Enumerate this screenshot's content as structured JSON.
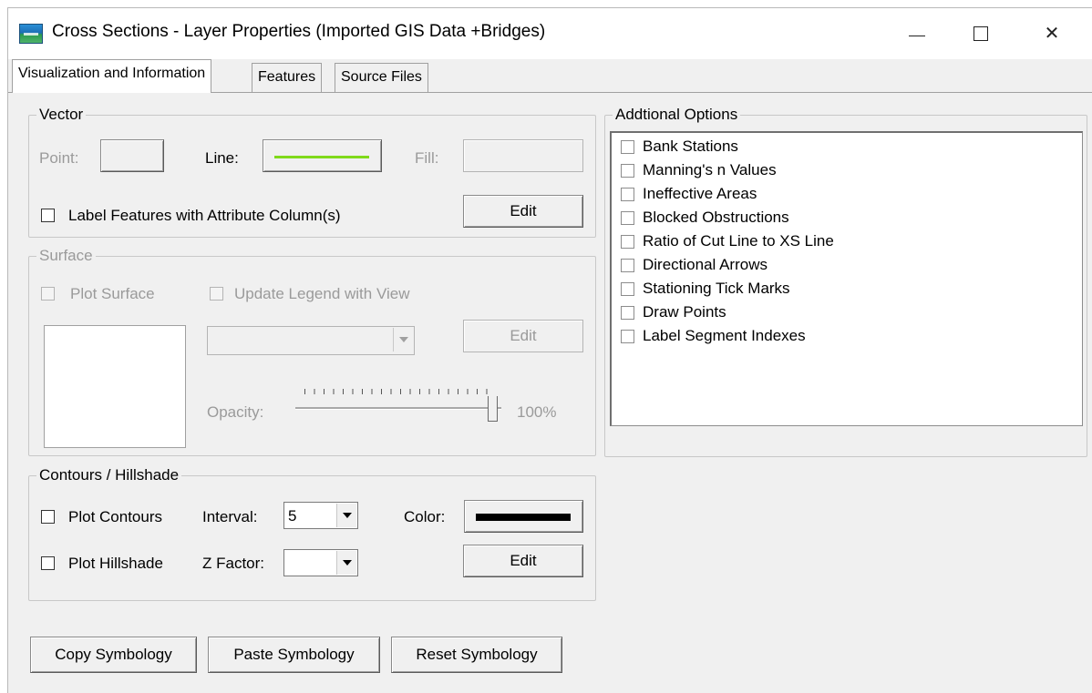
{
  "window": {
    "title": "Cross Sections - Layer Properties (Imported GIS Data +Bridges)",
    "minimize_glyph": "—",
    "maximize_glyph": "☐",
    "close_glyph": "✕"
  },
  "tabs": [
    {
      "label": "Visualization and Information",
      "active": true
    },
    {
      "label": "Features",
      "active": false
    },
    {
      "label": "Source Files",
      "active": false
    }
  ],
  "vector": {
    "legend": "Vector",
    "point_label": "Point:",
    "line_label": "Line:",
    "fill_label": "Fill:",
    "line_color": "#7fd91a",
    "label_features_label": "Label Features with Attribute Column(s)",
    "label_features_checked": false,
    "edit_label": "Edit"
  },
  "surface": {
    "legend": "Surface",
    "plot_surface_label": "Plot Surface",
    "update_legend_label": "Update Legend with View",
    "edit_label": "Edit",
    "opacity_label": "Opacity:",
    "opacity_value": "100%",
    "opacity_fraction": 1.0,
    "enabled": false
  },
  "contours": {
    "legend": "Contours / Hillshade",
    "plot_contours_label": "Plot Contours",
    "interval_label": "Interval:",
    "interval_value": "5",
    "color_label": "Color:",
    "contour_color": "#000000",
    "plot_hillshade_label": "Plot Hillshade",
    "zfactor_label": "Z Factor:",
    "zfactor_value": "",
    "edit_label": "Edit"
  },
  "additional_options": {
    "legend": "Addtional Options",
    "items": [
      {
        "label": "Bank Stations",
        "checked": false
      },
      {
        "label": "Manning's n Values",
        "checked": false
      },
      {
        "label": "Ineffective Areas",
        "checked": false
      },
      {
        "label": "Blocked Obstructions",
        "checked": false
      },
      {
        "label": "Ratio of Cut Line to XS Line",
        "checked": false
      },
      {
        "label": "Directional Arrows",
        "checked": false
      },
      {
        "label": "Stationing Tick Marks",
        "checked": false
      },
      {
        "label": "Draw Points",
        "checked": false
      },
      {
        "label": "Label Segment Indexes",
        "checked": false
      }
    ]
  },
  "footer": {
    "copy_label": "Copy Symbology",
    "paste_label": "Paste Symbology",
    "reset_label": "Reset Symbology"
  }
}
